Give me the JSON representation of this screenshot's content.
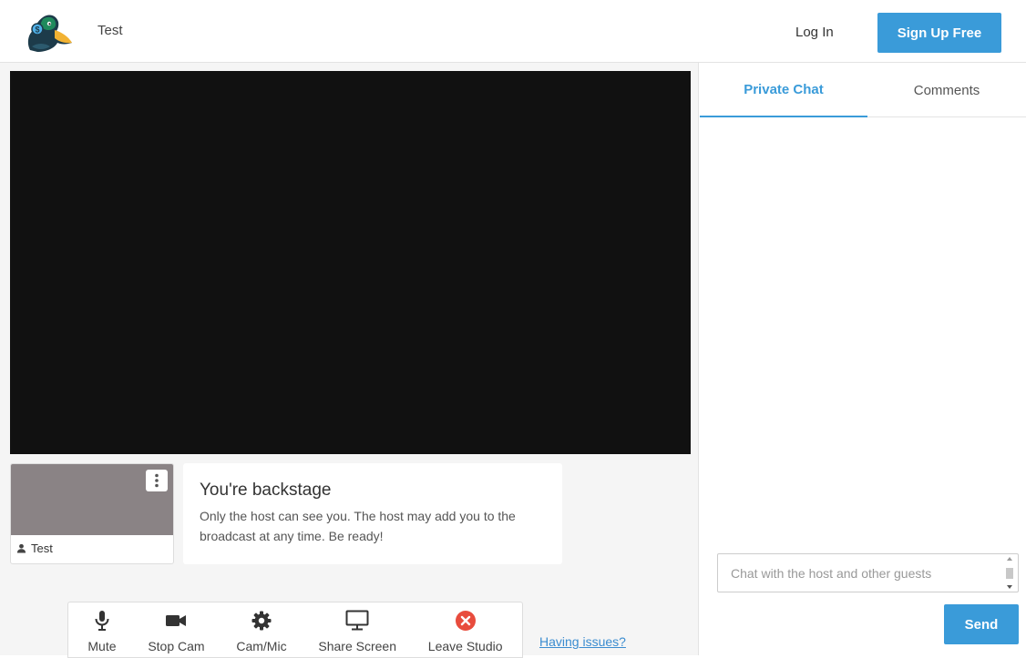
{
  "header": {
    "title": "Test",
    "login_label": "Log In",
    "signup_label": "Sign Up Free",
    "logo_icon": "duck-logo-icon"
  },
  "self_tile": {
    "name": "Test",
    "menu_icon": "more-vertical-icon",
    "user_icon": "person-icon"
  },
  "backstage": {
    "title": "You're backstage",
    "message": "Only the host can see you. The host may add you to the broadcast at any time. Be ready!"
  },
  "toolbar": {
    "items": [
      {
        "label": "Mute",
        "icon": "microphone-icon"
      },
      {
        "label": "Stop Cam",
        "icon": "camera-icon"
      },
      {
        "label": "Cam/Mic",
        "icon": "gear-icon"
      },
      {
        "label": "Share Screen",
        "icon": "monitor-icon"
      },
      {
        "label": "Leave Studio",
        "icon": "close-circle-icon"
      }
    ]
  },
  "issues_link": "Having issues?",
  "sidebar": {
    "tabs": [
      {
        "label": "Private Chat",
        "active": true
      },
      {
        "label": "Comments",
        "active": false
      }
    ],
    "chat_placeholder": "Chat with the host and other guests",
    "send_label": "Send"
  },
  "colors": {
    "accent": "#3a9bd9",
    "video_bg": "#111111",
    "leave": "#e84c3d"
  }
}
